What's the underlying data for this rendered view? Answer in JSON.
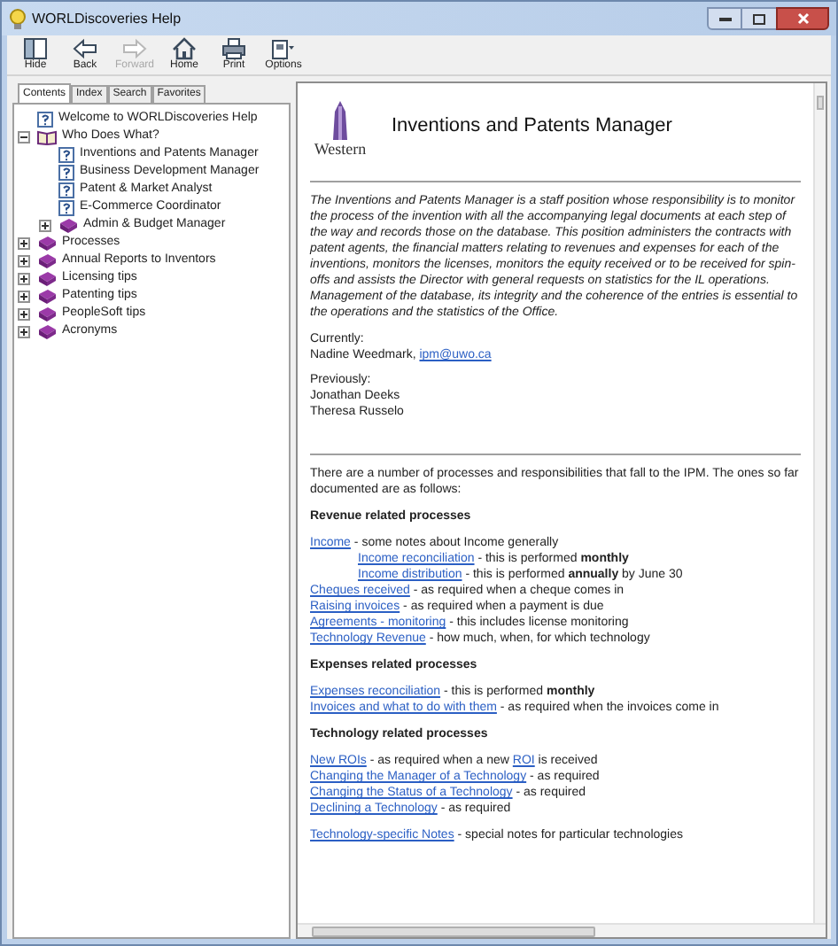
{
  "window": {
    "title": "WORLDiscoveries Help"
  },
  "toolbar": [
    {
      "label": "Hide",
      "kind": "hide",
      "disabled": false
    },
    {
      "label": "Back",
      "kind": "back",
      "disabled": false
    },
    {
      "label": "Forward",
      "kind": "forward",
      "disabled": true
    },
    {
      "label": "Home",
      "kind": "home",
      "disabled": false
    },
    {
      "label": "Print",
      "kind": "print",
      "disabled": false
    },
    {
      "label": "Options",
      "kind": "options",
      "disabled": false
    }
  ],
  "tabs": [
    {
      "label": "Contents",
      "selected": true
    },
    {
      "label": "Index",
      "selected": false
    },
    {
      "label": "Search",
      "selected": false
    },
    {
      "label": "Favorites",
      "selected": false
    }
  ],
  "tree": [
    {
      "label": "Welcome to WORLDiscoveries Help",
      "kind": "page"
    },
    {
      "label": "Who Does What?",
      "kind": "book",
      "expanded": true,
      "children": [
        {
          "label": "Inventions and Patents Manager",
          "kind": "page"
        },
        {
          "label": "Business Development Manager",
          "kind": "page"
        },
        {
          "label": "Patent & Market Analyst",
          "kind": "page"
        },
        {
          "label": "E-Commerce Coordinator",
          "kind": "page"
        },
        {
          "label": "Admin & Budget Manager",
          "kind": "book",
          "expanded": false
        }
      ]
    },
    {
      "label": "Processes",
      "kind": "book",
      "expanded": false
    },
    {
      "label": "Annual Reports to Inventors",
      "kind": "book",
      "expanded": false
    },
    {
      "label": "Licensing tips",
      "kind": "book",
      "expanded": false
    },
    {
      "label": "Patenting tips",
      "kind": "book",
      "expanded": false
    },
    {
      "label": "PeopleSoft tips",
      "kind": "book",
      "expanded": false
    },
    {
      "label": "Acronyms",
      "kind": "book",
      "expanded": false
    }
  ],
  "page": {
    "logo_text": "Western",
    "title": "Inventions and Patents Manager",
    "intro": "The Inventions and Patents Manager is a staff position whose responsibility is to monitor the process of the invention with all the accompanying legal documents at each step of the way and records those on the database. This position administers the contracts with patent agents, the financial matters relating to revenues and expenses for each of the inventions, monitors the licenses, monitors the equity received or to be received for spin-offs and assists the Director with general requests on statistics for the IL operations. Management of the database, its integrity and the coherence of the entries is essential to the operations and the statistics of the Office.",
    "currently_label": "Currently:",
    "current_name": "Nadine Weedmark, ",
    "current_email": "ipm@uwo.ca",
    "previously_label": "Previously:",
    "previous": [
      "Jonathan Deeks",
      "Theresa Russelo"
    ],
    "processes_intro": "There are a number of processes and responsibilities that fall to the IPM. The ones so far documented are as follows:",
    "sections": [
      {
        "heading": "Revenue related processes",
        "lines": [
          {
            "parts": [
              {
                "kind": "link",
                "text": "Income"
              },
              {
                "kind": "text",
                "text": " - some notes about Income generally"
              }
            ],
            "children": [
              {
                "parts": [
                  {
                    "kind": "link",
                    "text": "Income reconciliation"
                  },
                  {
                    "kind": "text",
                    "text": " - this is performed **monthly**"
                  }
                ]
              },
              {
                "parts": [
                  {
                    "kind": "link",
                    "text": "Income distribution"
                  },
                  {
                    "kind": "text",
                    "text": " - this is performed **annually** by June 30"
                  }
                ]
              }
            ]
          },
          {
            "parts": [
              {
                "kind": "link",
                "text": "Cheques received"
              },
              {
                "kind": "text",
                "text": " - as required when a cheque comes in"
              }
            ]
          },
          {
            "parts": [
              {
                "kind": "link",
                "text": "Raising invoices"
              },
              {
                "kind": "text",
                "text": " - as required when a payment is due"
              }
            ]
          },
          {
            "parts": [
              {
                "kind": "link",
                "text": "Agreements - monitoring"
              },
              {
                "kind": "text",
                "text": " - this includes license monitoring"
              }
            ]
          },
          {
            "parts": [
              {
                "kind": "link",
                "text": "Technology Revenue"
              },
              {
                "kind": "text",
                "text": " - how much, when, for which technology"
              }
            ]
          }
        ]
      },
      {
        "heading": "Expenses related processes",
        "lines": [
          {
            "parts": [
              {
                "kind": "link",
                "text": "Expenses reconciliation"
              },
              {
                "kind": "text",
                "text": " - this is performed **monthly**"
              }
            ]
          },
          {
            "parts": [
              {
                "kind": "link",
                "text": "Invoices and what to do with them"
              },
              {
                "kind": "text",
                "text": " - as required when the invoices come in"
              }
            ]
          }
        ]
      },
      {
        "heading": "Technology related processes",
        "lines": [
          {
            "parts": [
              {
                "kind": "link",
                "text": "New ROIs"
              },
              {
                "kind": "text",
                "text": " - as required when a new "
              },
              {
                "kind": "link",
                "text": "ROI"
              },
              {
                "kind": "text",
                "text": " is received"
              }
            ]
          },
          {
            "parts": [
              {
                "kind": "link",
                "text": "Changing the Manager of a Technology"
              },
              {
                "kind": "text",
                "text": " - as required"
              }
            ]
          },
          {
            "parts": [
              {
                "kind": "link",
                "text": "Changing the Status of a Technology"
              },
              {
                "kind": "text",
                "text": " - as required"
              }
            ]
          },
          {
            "parts": [
              {
                "kind": "link",
                "text": "Declining a Technology"
              },
              {
                "kind": "text",
                "text": " - as required"
              }
            ]
          }
        ]
      },
      {
        "lines": [
          {
            "parts": [
              {
                "kind": "link",
                "text": "Technology-specific Notes"
              },
              {
                "kind": "text",
                "text": " - special notes for particular technologies"
              }
            ]
          }
        ]
      }
    ]
  }
}
